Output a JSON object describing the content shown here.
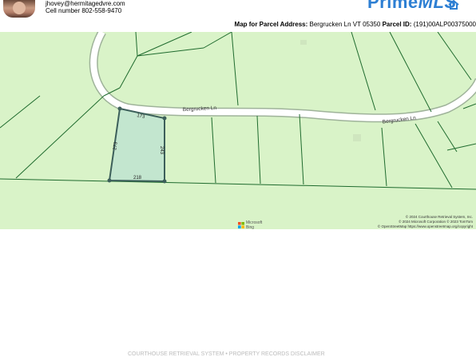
{
  "agent": {
    "email": "jhovey@hermitagedvre.com",
    "phone": "Cell number 802-558-9470"
  },
  "brand": {
    "prefix": "Prime",
    "suffix": "MLS",
    "color": "#2d7fd3"
  },
  "map_header": {
    "label_address": "Map for Parcel Address:",
    "address": "Bergrucken Ln VT 05350",
    "label_parcel": "Parcel ID:",
    "parcel_id": "(191)00ALP00375000"
  },
  "map": {
    "road_name_1": "Bergrucken Ln",
    "road_name_2": "Bergrucken Ln",
    "parcel_edges": {
      "top": "173",
      "left": "273",
      "right": "243",
      "bottom": "218"
    },
    "colors": {
      "land": "#d9f3c8",
      "parcel_fill": "#c3e6cf",
      "parcel_stroke": "#3c5f5a",
      "lines": "#1f6b2e",
      "road": "#ffffff"
    }
  },
  "attribution": {
    "line1": "© 2024 Courthouse Retrieval System, Inc.",
    "line2": "© 2024 Microsoft Corporation © 2023 TomTom",
    "line3": "© OpenStreetMap https://www.openstreetmap.org/copyright",
    "ms_name": "Microsoft",
    "ms_sub": "Bing"
  },
  "footer": {
    "disclaimer": "COURTHOUSE RETRIEVAL SYSTEM • PROPERTY RECORDS DISCLAIMER"
  }
}
